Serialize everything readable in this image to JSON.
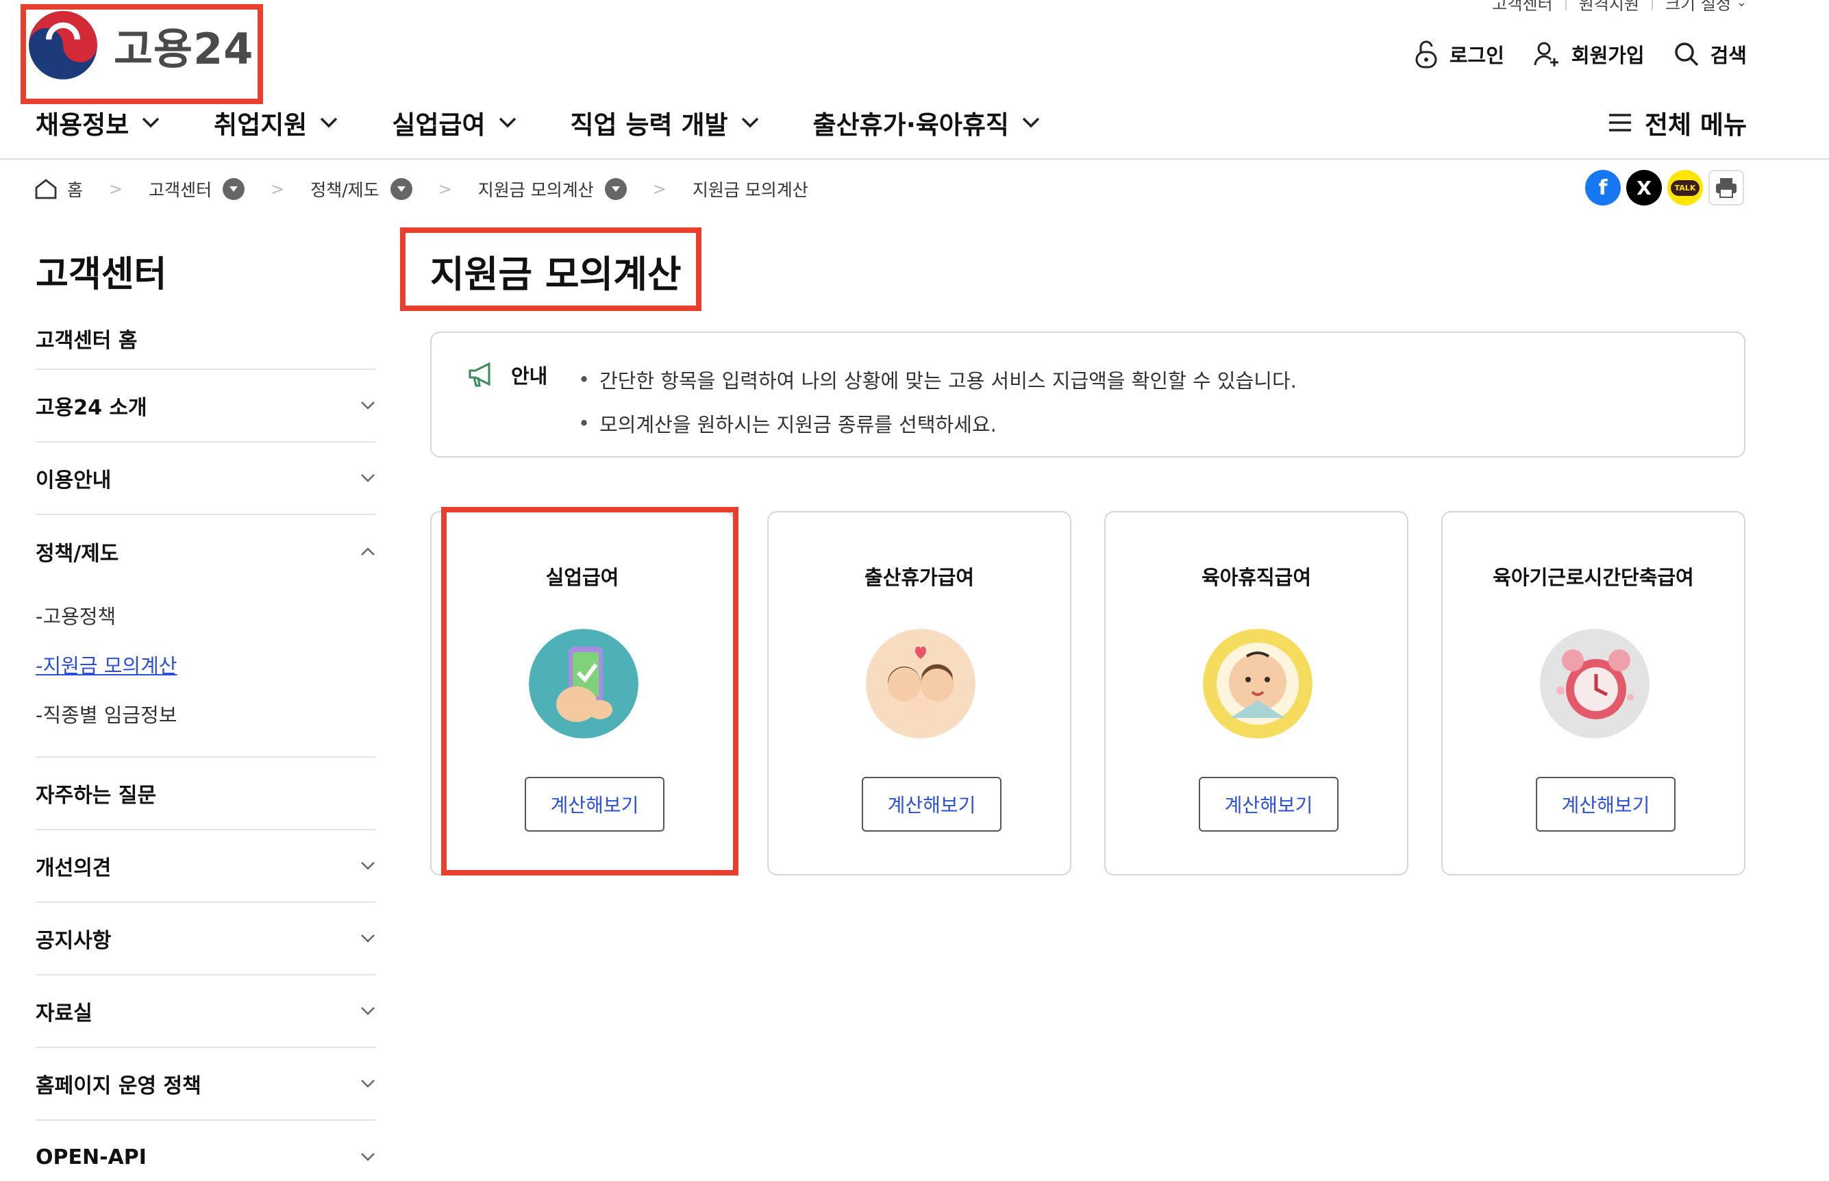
{
  "header": {
    "util_links": [
      "고객센터",
      "원격지원",
      "크기 설정"
    ],
    "logo_text": "고용24",
    "actions": {
      "login": "로그인",
      "signup": "회원가입",
      "search": "검색"
    }
  },
  "gnb": {
    "items": [
      "채용정보",
      "취업지원",
      "실업급여",
      "직업 능력 개발",
      "출산휴가·육아휴직"
    ],
    "all_menu": "전체 메뉴"
  },
  "breadcrumb": [
    "홈",
    "고객센터",
    "정책/제도",
    "지원금 모의계산",
    "지원금 모의계산"
  ],
  "share": {
    "kakao_label": "TALK"
  },
  "sidebar": {
    "title": "고객센터",
    "items": [
      {
        "label": "고객센터 홈"
      },
      {
        "label": "고용24 소개"
      },
      {
        "label": "이용안내"
      },
      {
        "label": "정책/제도"
      },
      {
        "label": "자주하는 질문"
      },
      {
        "label": "개선의견"
      },
      {
        "label": "공지사항"
      },
      {
        "label": "자료실"
      },
      {
        "label": "홈페이지 운영 정책"
      },
      {
        "label": "OPEN-API"
      }
    ],
    "sub_items": [
      "-고용정책",
      "-지원금 모의계산",
      "-직종별 임금정보"
    ]
  },
  "main": {
    "title": "지원금 모의계산",
    "notice": {
      "label": "안내",
      "lines": [
        "간단한 항목을 입력하여 나의 상황에 맞는 고용 서비스 지급액을 확인할 수 있습니다.",
        "모의계산을 원하시는 지원금 종류를 선택하세요."
      ]
    },
    "cards": [
      {
        "title": "실업급여",
        "button": "계산해보기"
      },
      {
        "title": "출산휴가급여",
        "button": "계산해보기"
      },
      {
        "title": "육아휴직급여",
        "button": "계산해보기"
      },
      {
        "title": "육아기근로시간단축급여",
        "button": "계산해보기"
      }
    ]
  },
  "colors": {
    "highlight": "#e8402f",
    "link_blue": "#2b4fd6",
    "facebook": "#1877f2",
    "kakao": "#fee500"
  }
}
